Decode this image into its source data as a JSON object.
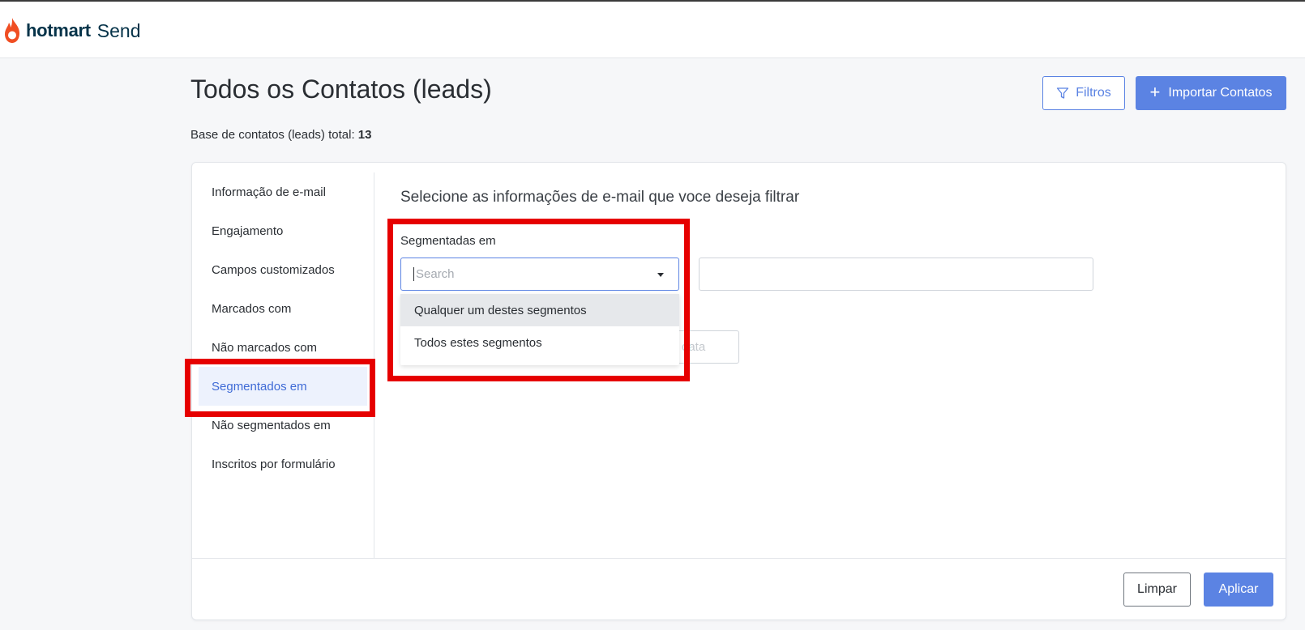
{
  "header": {
    "brand": "hotmart",
    "product": "Send"
  },
  "page": {
    "title": "Todos os Contatos (leads)",
    "total_label": "Base de contatos (leads) total:",
    "total_value": "13"
  },
  "toolbar": {
    "filters_label": "Filtros",
    "import_label": "Importar Contatos"
  },
  "sidebar": {
    "items": [
      {
        "label": "Informação de e-mail"
      },
      {
        "label": "Engajamento"
      },
      {
        "label": "Campos customizados"
      },
      {
        "label": "Marcados com"
      },
      {
        "label": "Não marcados com"
      },
      {
        "label": "Segmentados em",
        "active": true
      },
      {
        "label": "Não segmentados em"
      },
      {
        "label": "Inscritos por formulário"
      }
    ]
  },
  "filter": {
    "title": "Selecione as informações de e-mail que voce deseja filtrar",
    "segment_label": "Segmentadas em",
    "search_placeholder": "Search",
    "date_placeholder": "data",
    "options": [
      {
        "label": "Qualquer um destes segmentos",
        "highlighted": true
      },
      {
        "label": "Todos estes segmentos"
      }
    ]
  },
  "footer": {
    "clear_label": "Limpar",
    "apply_label": "Aplicar"
  },
  "colors": {
    "primary": "#5b83e3",
    "brand": "#053349",
    "flame": "#f04e23",
    "highlight": "#e60000"
  }
}
